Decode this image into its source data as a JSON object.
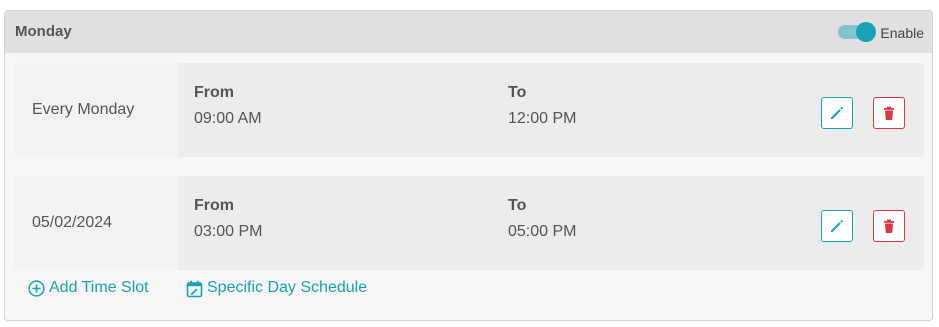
{
  "schedule": {
    "day_title": "Monday",
    "enable_label": "Enable",
    "enabled": true,
    "accent_color": "#17a2b8",
    "danger_color": "#dc3545",
    "slots": [
      {
        "label": "Every Monday",
        "from_header": "From",
        "from_value": "09:00 AM",
        "to_header": "To",
        "to_value": "12:00 PM",
        "edit_icon": "pencil-icon",
        "delete_icon": "trash-icon"
      },
      {
        "label": "05/02/2024",
        "from_header": "From",
        "from_value": "03:00 PM",
        "to_header": "To",
        "to_value": "05:00 PM",
        "edit_icon": "pencil-icon",
        "delete_icon": "trash-icon"
      }
    ],
    "add_time_slot": {
      "label": "Add Time Slot",
      "icon": "plus-circle-icon"
    },
    "specific_day_schedule": {
      "label": "Specific Day Schedule",
      "icon": "calendar-edit-icon"
    }
  }
}
